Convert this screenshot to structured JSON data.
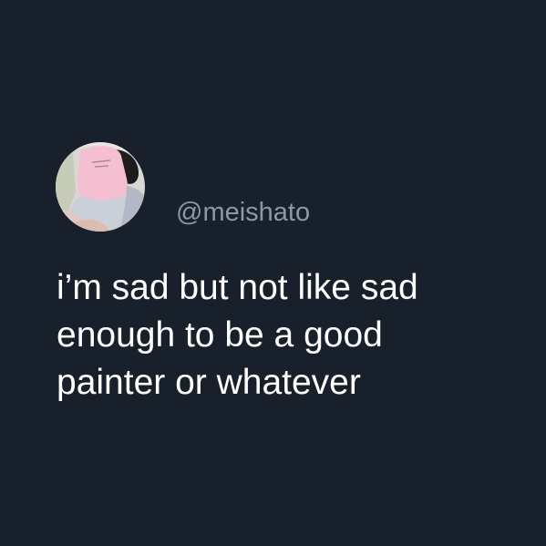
{
  "post": {
    "handle": "@meishato",
    "text_lines": [
      "i’m sad but not like sad",
      "enough to be a good",
      "painter or whatever"
    ]
  },
  "avatar": {
    "icon": "profile-photo-avatar"
  },
  "colors": {
    "background": "#17202b",
    "handle_text": "#8b98a5",
    "body_text": "#ffffff"
  }
}
